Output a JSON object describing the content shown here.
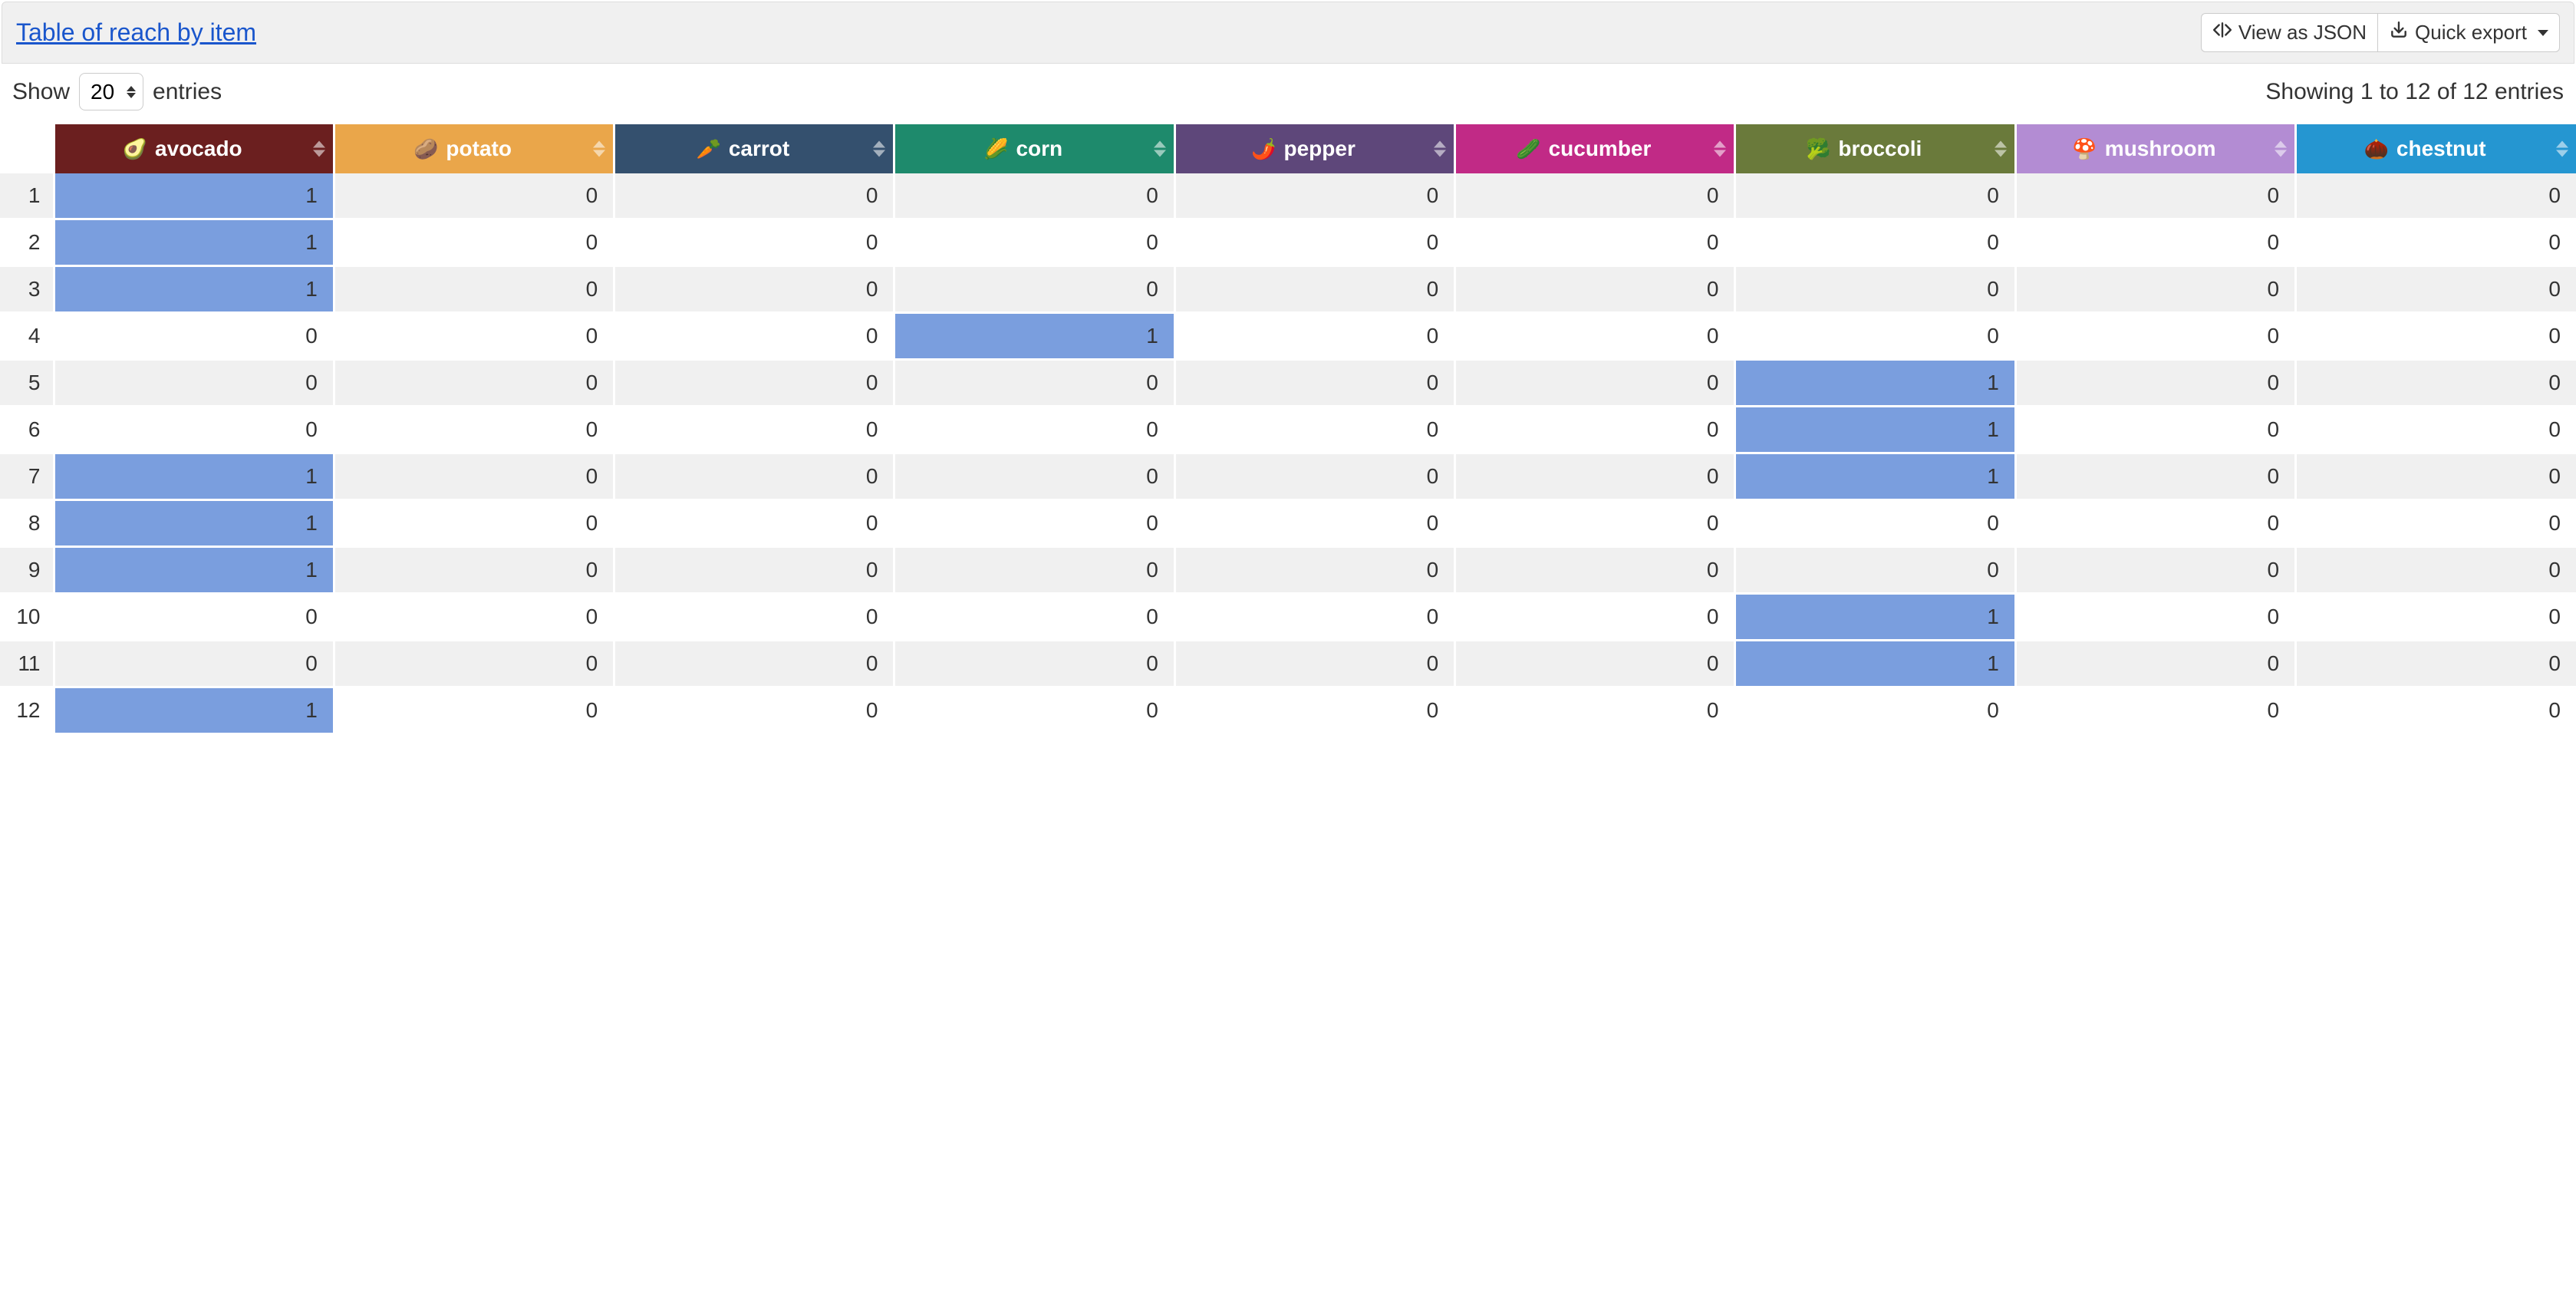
{
  "header": {
    "title": "Table of reach by item",
    "view_json_label": "View as JSON",
    "quick_export_label": "Quick export"
  },
  "controls": {
    "show_label": "Show",
    "entries_label": "entries",
    "page_size": "20",
    "info": "Showing 1 to 12 of 12 entries"
  },
  "columns": [
    {
      "key": "avocado",
      "label": "avocado",
      "emoji": "🥑",
      "color": "#6b1f1f"
    },
    {
      "key": "potato",
      "label": "potato",
      "emoji": "🥔",
      "color": "#eaa64a"
    },
    {
      "key": "carrot",
      "label": "carrot",
      "emoji": "🥕",
      "color": "#34506e"
    },
    {
      "key": "corn",
      "label": "corn",
      "emoji": "🌽",
      "color": "#1e8a6c"
    },
    {
      "key": "pepper",
      "label": "pepper",
      "emoji": "🌶️",
      "color": "#5e477a"
    },
    {
      "key": "cucumber",
      "label": "cucumber",
      "emoji": "🥒",
      "color": "#c12a86"
    },
    {
      "key": "broccoli",
      "label": "broccoli",
      "emoji": "🥦",
      "color": "#6a7a3b"
    },
    {
      "key": "mushroom",
      "label": "mushroom",
      "emoji": "🍄",
      "color": "#b38cd3"
    },
    {
      "key": "chestnut",
      "label": "chestnut",
      "emoji": "🌰",
      "color": "#2596d1"
    }
  ],
  "rows": [
    {
      "n": 1,
      "avocado": 1,
      "potato": 0,
      "carrot": 0,
      "corn": 0,
      "pepper": 0,
      "cucumber": 0,
      "broccoli": 0,
      "mushroom": 0,
      "chestnut": 0
    },
    {
      "n": 2,
      "avocado": 1,
      "potato": 0,
      "carrot": 0,
      "corn": 0,
      "pepper": 0,
      "cucumber": 0,
      "broccoli": 0,
      "mushroom": 0,
      "chestnut": 0
    },
    {
      "n": 3,
      "avocado": 1,
      "potato": 0,
      "carrot": 0,
      "corn": 0,
      "pepper": 0,
      "cucumber": 0,
      "broccoli": 0,
      "mushroom": 0,
      "chestnut": 0
    },
    {
      "n": 4,
      "avocado": 0,
      "potato": 0,
      "carrot": 0,
      "corn": 1,
      "pepper": 0,
      "cucumber": 0,
      "broccoli": 0,
      "mushroom": 0,
      "chestnut": 0
    },
    {
      "n": 5,
      "avocado": 0,
      "potato": 0,
      "carrot": 0,
      "corn": 0,
      "pepper": 0,
      "cucumber": 0,
      "broccoli": 1,
      "mushroom": 0,
      "chestnut": 0
    },
    {
      "n": 6,
      "avocado": 0,
      "potato": 0,
      "carrot": 0,
      "corn": 0,
      "pepper": 0,
      "cucumber": 0,
      "broccoli": 1,
      "mushroom": 0,
      "chestnut": 0
    },
    {
      "n": 7,
      "avocado": 1,
      "potato": 0,
      "carrot": 0,
      "corn": 0,
      "pepper": 0,
      "cucumber": 0,
      "broccoli": 1,
      "mushroom": 0,
      "chestnut": 0
    },
    {
      "n": 8,
      "avocado": 1,
      "potato": 0,
      "carrot": 0,
      "corn": 0,
      "pepper": 0,
      "cucumber": 0,
      "broccoli": 0,
      "mushroom": 0,
      "chestnut": 0
    },
    {
      "n": 9,
      "avocado": 1,
      "potato": 0,
      "carrot": 0,
      "corn": 0,
      "pepper": 0,
      "cucumber": 0,
      "broccoli": 0,
      "mushroom": 0,
      "chestnut": 0
    },
    {
      "n": 10,
      "avocado": 0,
      "potato": 0,
      "carrot": 0,
      "corn": 0,
      "pepper": 0,
      "cucumber": 0,
      "broccoli": 1,
      "mushroom": 0,
      "chestnut": 0
    },
    {
      "n": 11,
      "avocado": 0,
      "potato": 0,
      "carrot": 0,
      "corn": 0,
      "pepper": 0,
      "cucumber": 0,
      "broccoli": 1,
      "mushroom": 0,
      "chestnut": 0
    },
    {
      "n": 12,
      "avocado": 1,
      "potato": 0,
      "carrot": 0,
      "corn": 0,
      "pepper": 0,
      "cucumber": 0,
      "broccoli": 0,
      "mushroom": 0,
      "chestnut": 0
    }
  ],
  "highlight_color": "#7a9ede"
}
